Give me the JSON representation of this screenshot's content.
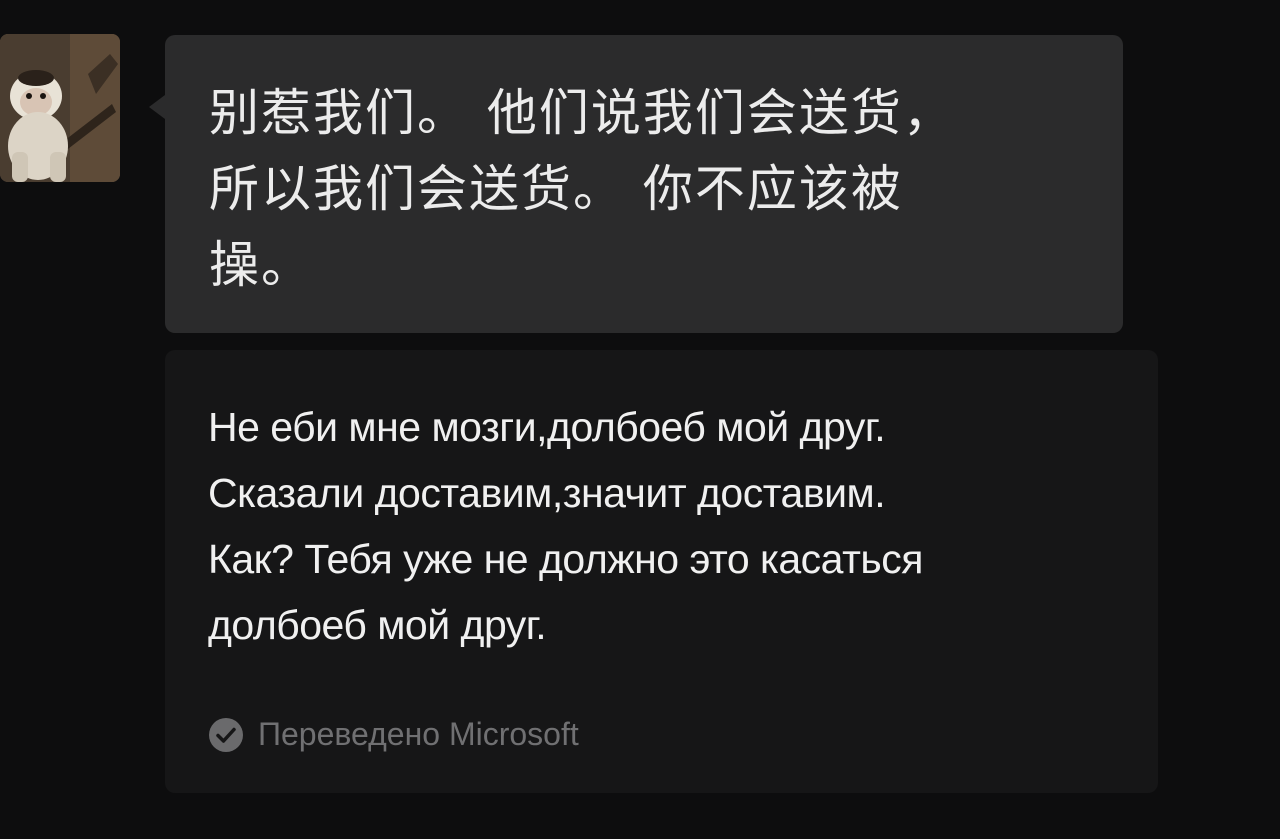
{
  "chat": {
    "avatar_alt": "avatar",
    "message": {
      "text": "别惹我们。 他们说我们会送货，\n所以我们会送货。 你不应该被\n操。"
    },
    "translation": {
      "text": "Не еби мне мозги,долбоеб мой друг.\nСказали доставим,значит доставим.\nКак? Тебя уже не должно это касаться\nдолбоеб мой друг.",
      "attribution": "Переведено Microsoft",
      "icon": "check-circle-icon"
    }
  },
  "colors": {
    "background": "#0d0d0e",
    "bubble": "#2b2b2c",
    "translation_card": "#161617",
    "muted_text": "#707072"
  }
}
